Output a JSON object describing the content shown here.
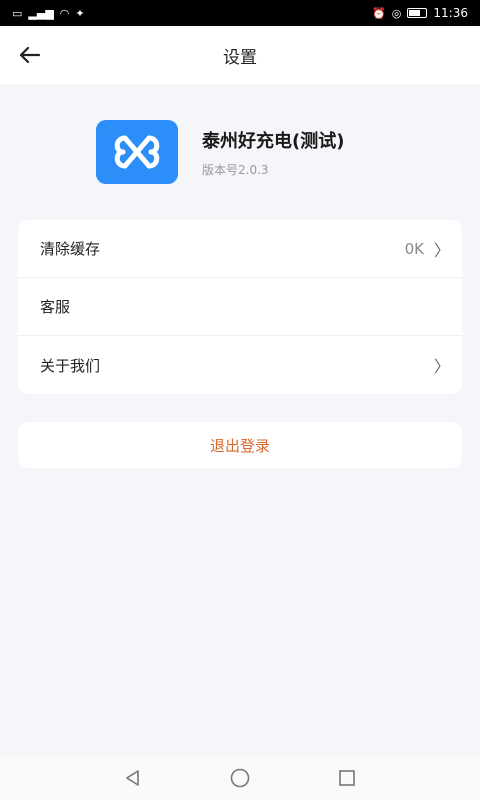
{
  "status_bar": {
    "left_icons": [
      "sim-icon",
      "signal-icon",
      "wifi-icon",
      "bird-icon"
    ],
    "time": "11:36",
    "battery_label": "64"
  },
  "header": {
    "title": "设置",
    "back_icon": "arrow-left-icon"
  },
  "app": {
    "name": "泰州好充电(测试)",
    "version": "版本号2.0.3",
    "logo_color": "#2c8ef8"
  },
  "menu": {
    "items": [
      {
        "label": "清除缓存",
        "value": "0K",
        "has_chevron": true
      },
      {
        "label": "客服",
        "value": "",
        "has_chevron": false
      },
      {
        "label": "关于我们",
        "value": "",
        "has_chevron": true
      }
    ]
  },
  "logout": {
    "label": "退出登录",
    "color": "#d9692e"
  },
  "nav": {
    "buttons": [
      "back-triangle-icon",
      "home-circle-icon",
      "recents-square-icon"
    ]
  }
}
